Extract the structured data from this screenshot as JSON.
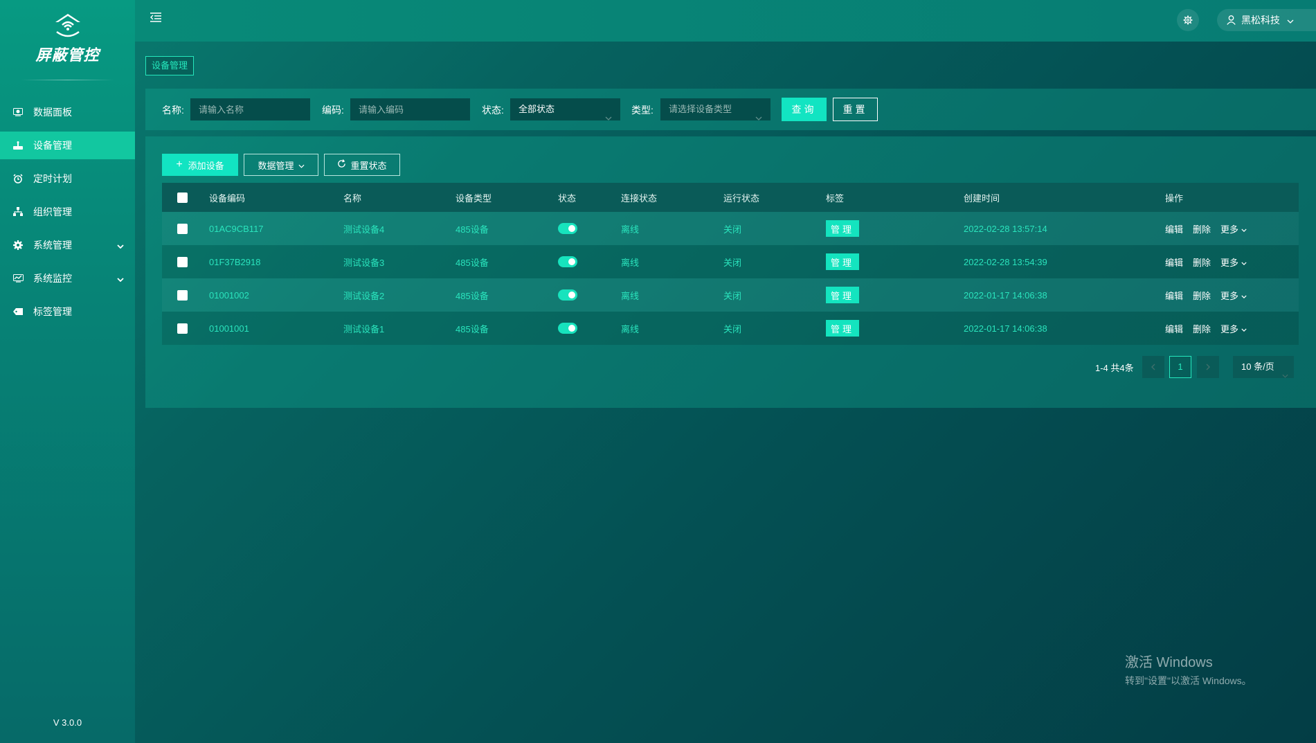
{
  "app": {
    "logo_text": "屏蔽管控",
    "version": "V 3.0.0"
  },
  "sidebar": {
    "items": [
      {
        "label": "数据面板",
        "icon": "dashboard-icon"
      },
      {
        "label": "设备管理",
        "icon": "device-icon",
        "active": true
      },
      {
        "label": "定时计划",
        "icon": "alarm-clock-icon"
      },
      {
        "label": "组织管理",
        "icon": "org-tree-icon"
      },
      {
        "label": "系统管理",
        "icon": "gear-icon",
        "expandable": true
      },
      {
        "label": "系统监控",
        "icon": "monitor-icon",
        "expandable": true
      },
      {
        "label": "标签管理",
        "icon": "tag-icon"
      }
    ]
  },
  "header": {
    "user_name": "黑松科技"
  },
  "breadcrumb": "设备管理",
  "filters": {
    "name_label": "名称:",
    "name_placeholder": "请输入名称",
    "code_label": "编码:",
    "code_placeholder": "请输入编码",
    "status_label": "状态:",
    "status_value": "全部状态",
    "type_label": "类型:",
    "type_placeholder": "请选择设备类型",
    "query_label": "查询",
    "reset_label": "重置"
  },
  "toolbar": {
    "add_label": "添加设备",
    "data_label": "数据管理",
    "reset_status_label": "重置状态"
  },
  "table": {
    "headers": {
      "code": "设备编码",
      "name": "名称",
      "type": "设备类型",
      "status": "状态",
      "conn": "连接状态",
      "run": "运行状态",
      "tag": "标签",
      "created": "创建时间",
      "ops": "操作"
    },
    "rows": [
      {
        "code": "01AC9CB117",
        "name": "测试设备4",
        "type": "485设备",
        "status_on": true,
        "conn": "离线",
        "run": "关闭",
        "tag": "管理",
        "created": "2022-02-28 13:57:14",
        "edit": "编辑",
        "delete": "删除",
        "more": "更多"
      },
      {
        "code": "01F37B2918",
        "name": "测试设备3",
        "type": "485设备",
        "status_on": true,
        "conn": "离线",
        "run": "关闭",
        "tag": "管理",
        "created": "2022-02-28 13:54:39",
        "edit": "编辑",
        "delete": "删除",
        "more": "更多"
      },
      {
        "code": "01001002",
        "name": "测试设备2",
        "type": "485设备",
        "status_on": true,
        "conn": "离线",
        "run": "关闭",
        "tag": "管理",
        "created": "2022-01-17 14:06:38",
        "edit": "编辑",
        "delete": "删除",
        "more": "更多"
      },
      {
        "code": "01001001",
        "name": "测试设备1",
        "type": "485设备",
        "status_on": true,
        "conn": "离线",
        "run": "关闭",
        "tag": "管理",
        "created": "2022-01-17 14:06:38",
        "edit": "编辑",
        "delete": "删除",
        "more": "更多"
      }
    ]
  },
  "pagination": {
    "info": "1-4 共4条",
    "current_page": "1",
    "page_size": "10 条/页"
  },
  "watermark": {
    "line1": "激活 Windows",
    "line2": "转到\"设置\"以激活 Windows。"
  },
  "colors": {
    "accent": "#12e4c2",
    "text_accent": "#2ae4bd",
    "sidebar_active": "#12c7a0"
  }
}
